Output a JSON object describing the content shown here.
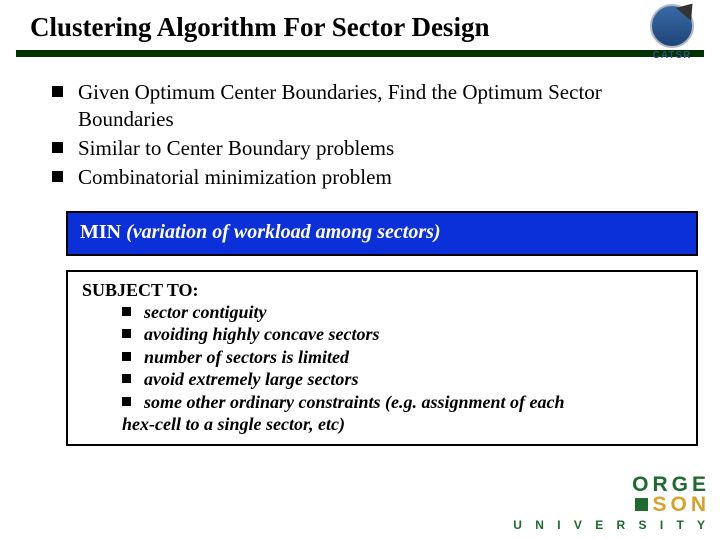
{
  "title": "Clustering Algorithm For Sector Design",
  "logo": {
    "text": "CATSR"
  },
  "bullets": [
    "Given Optimum Center Boundaries, Find the Optimum Sector Boundaries",
    "Similar to Center Boundary problems",
    "Combinatorial minimization problem"
  ],
  "min_box": {
    "label": "MIN",
    "rest": " (variation of workload among sectors)"
  },
  "subject_box": {
    "heading": "SUBJECT TO:",
    "items": [
      "sector contiguity",
      "avoiding highly concave sectors",
      "number of sectors is limited",
      "avoid extremely large sectors",
      "some other ordinary constraints (e.g. assignment of each"
    ],
    "tail": "hex-cell to a single sector, etc)"
  },
  "university": {
    "line1": "ORGE",
    "line2": "SON",
    "line3": "U N I V E R S I T Y"
  }
}
